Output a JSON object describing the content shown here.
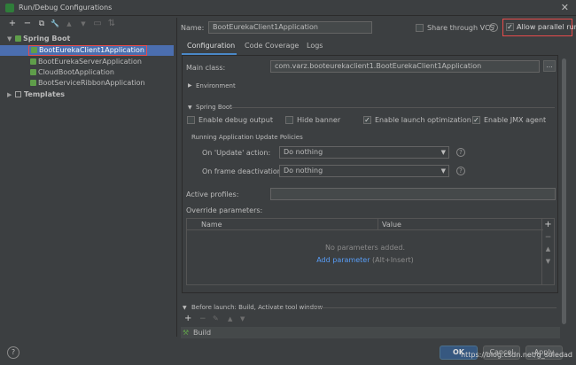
{
  "window": {
    "title": "Run/Debug Configurations",
    "close": "✕"
  },
  "toolbar": {
    "add": "+",
    "remove": "−",
    "copy": "⧉",
    "settings": "🔧",
    "up": "▲",
    "down": "▼",
    "folder": "▭",
    "sort": "⇅"
  },
  "tree": {
    "spring_boot": "Spring Boot",
    "items": [
      "BootEurekaClient1Application",
      "BootEurekaServerApplication",
      "CloudBootApplication",
      "BootServiceRibbonApplication"
    ],
    "templates": "Templates"
  },
  "name": {
    "label": "Name:",
    "value": "BootEurekaClient1Application"
  },
  "share_vcs": {
    "label": "Share through VCS",
    "checked": false
  },
  "allow_parallel": {
    "label": "Allow parallel run",
    "checked": true
  },
  "tabs": [
    "Configuration",
    "Code Coverage",
    "Logs"
  ],
  "main_class": {
    "label": "Main class:",
    "value": "com.varz.booteurekaclient1.BootEurekaClient1Application",
    "browse": "..."
  },
  "environment": {
    "label": "Environment"
  },
  "spring_boot_section": {
    "title": "Spring Boot",
    "options": [
      {
        "label": "Enable debug output",
        "checked": false
      },
      {
        "label": "Hide banner",
        "checked": false
      },
      {
        "label": "Enable launch optimization",
        "checked": true
      },
      {
        "label": "Enable JMX agent",
        "checked": true
      }
    ]
  },
  "update_policies": {
    "title": "Running Application Update Policies",
    "on_update": {
      "label": "On 'Update' action:",
      "value": "Do nothing"
    },
    "on_deactivation": {
      "label": "On frame deactivation:",
      "value": "Do nothing"
    }
  },
  "active_profiles": {
    "label": "Active profiles:",
    "value": ""
  },
  "override_parameters": {
    "label": "Override parameters:",
    "columns": [
      "Name",
      "Value"
    ],
    "empty_text": "No parameters added.",
    "add_link": "Add parameter",
    "add_hint": "(Alt+Insert)"
  },
  "before_launch": {
    "title": "Before launch: Build, Activate tool window",
    "items": [
      "Build"
    ]
  },
  "buttons": {
    "ok": "OK",
    "cancel": "Cancel",
    "apply": "Apply",
    "help": "?"
  },
  "watermark": "https://blog.csdn.net/g_soledad"
}
